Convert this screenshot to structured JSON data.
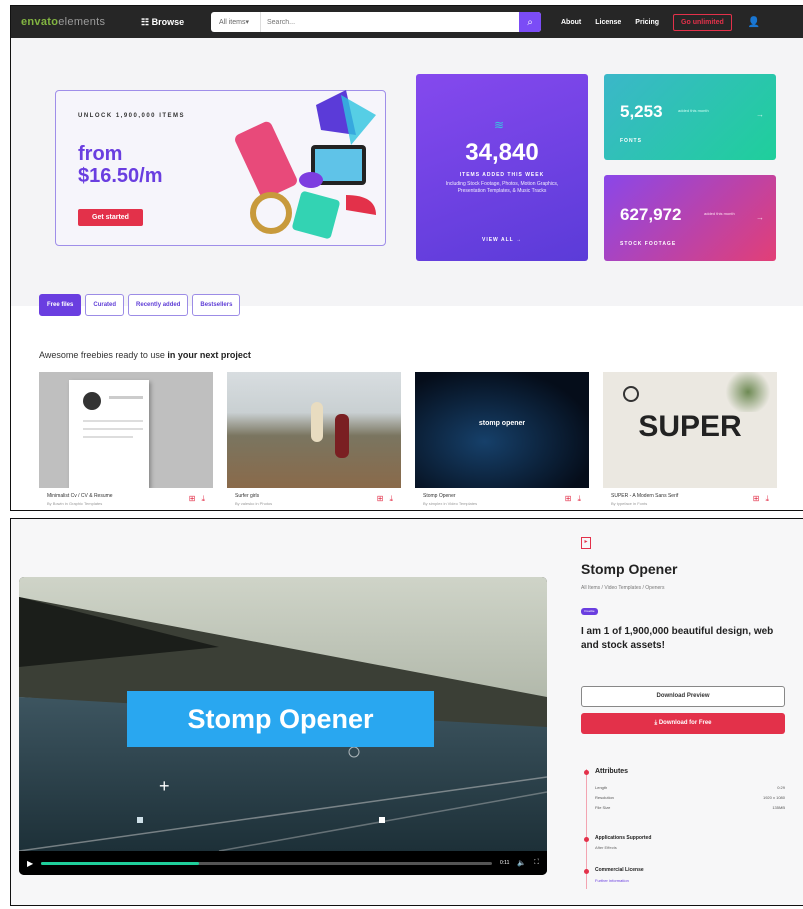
{
  "nav": {
    "logo_main": "envato",
    "logo_dim": "elements",
    "browse": "Browse",
    "search_category": "All items",
    "search_placeholder": "Search...",
    "links": [
      "About",
      "License",
      "Pricing"
    ],
    "unlimited_label": "Go unlimited"
  },
  "hero": {
    "unlock": "UNLOCK 1,900,000 ITEMS",
    "price_line1": "from",
    "price_line2": "$16.50/m",
    "cta": "Get started"
  },
  "stats": {
    "main": {
      "value": "34,840",
      "label": "ITEMS ADDED THIS WEEK",
      "desc": "Including Stock Footage, Photos, Motion Graphics, Presentation Templates, & Music Tracks",
      "link": "VIEW ALL"
    },
    "fonts": {
      "value": "5,253",
      "label": "FONTS",
      "note": "added this month"
    },
    "footage": {
      "value": "627,972",
      "label": "STOCK FOOTAGE",
      "note": "added this month"
    }
  },
  "tabs": [
    "Free files",
    "Curated",
    "Recently added",
    "Bestsellers"
  ],
  "section_heading": {
    "plain": "Awesome freebies ready to use ",
    "bold": "in your next project"
  },
  "cards": [
    {
      "title": "Minimalist Cv / CV & Resume",
      "by": "By Bowin in Graphic Templates",
      "img_text": ""
    },
    {
      "title": "Surfer girls",
      "by": "By valesko in Photos",
      "img_text": ""
    },
    {
      "title": "Stomp Opener",
      "by": "By simplex in Video Templates",
      "img_text": "stomp opener"
    },
    {
      "title": "SUPER - A Modern Sans Serif",
      "by": "By typeface in Fonts",
      "img_text": "SUPER"
    }
  ],
  "product": {
    "title": "Stomp Opener",
    "breadcrumb": "All Items / Video Templates / Openers",
    "badge": "Freebie",
    "pitch": "I am 1 of 1,900,000 beautiful design, web and stock assets!",
    "preview_button": "Download Preview",
    "download_button": "Download for Free",
    "video_title": "Stomp Opener",
    "video_time": "0:11",
    "video_progress": 0.35,
    "attributes_heading": "Attributes",
    "attributes": [
      {
        "key": "Length",
        "value": "0:29"
      },
      {
        "key": "Resolution",
        "value": "1920 x 1080"
      },
      {
        "key": "File Size",
        "value": "135MB"
      }
    ],
    "apps_heading": "Applications Supported",
    "apps_value": "After Effects",
    "license_heading": "Commercial License",
    "license_link": "Further information"
  }
}
